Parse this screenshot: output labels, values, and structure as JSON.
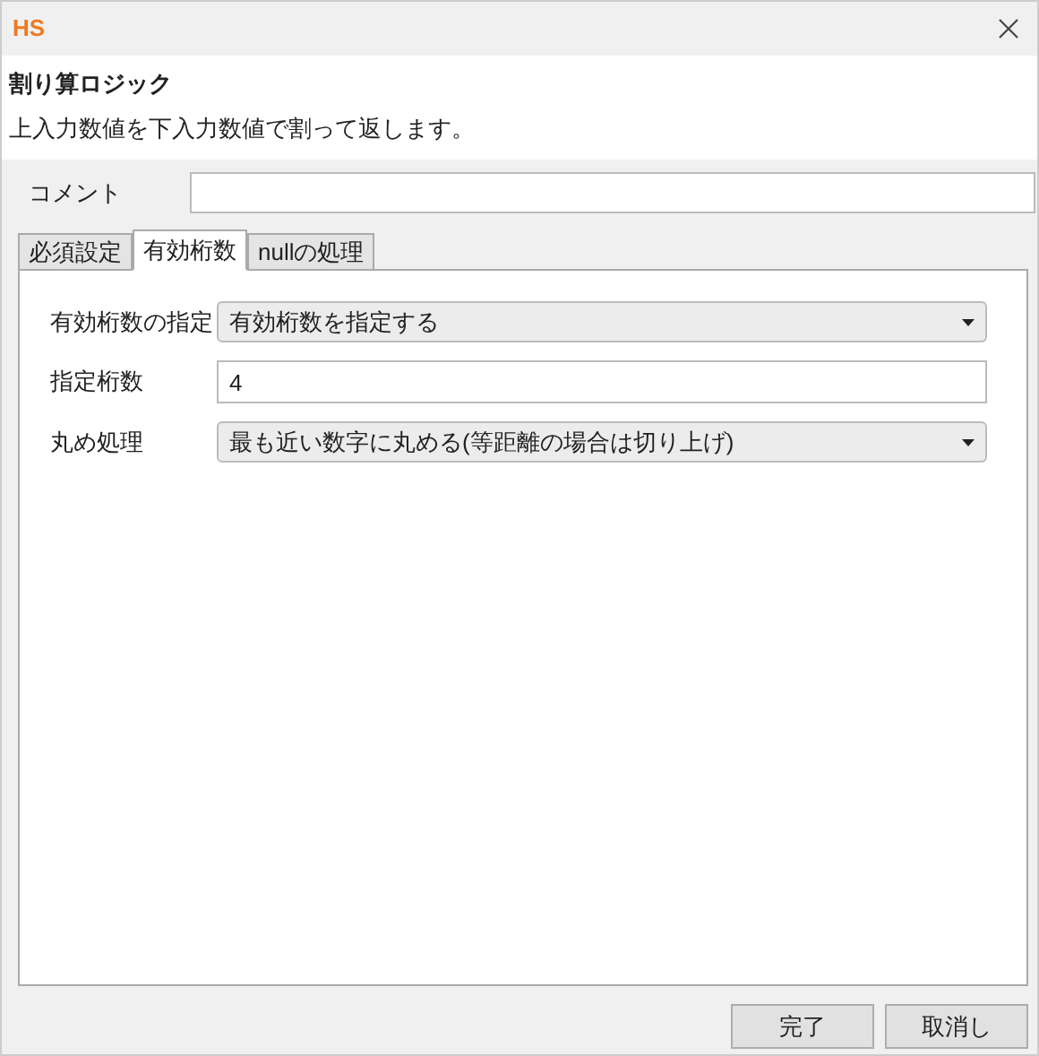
{
  "window": {
    "logo": "HS"
  },
  "header": {
    "title": "割り算ロジック",
    "description": "上入力数値を下入力数値で割って返します。"
  },
  "comment": {
    "label": "コメント"
  },
  "tabs": [
    {
      "label": "必須設定",
      "selected": false
    },
    {
      "label": "有効桁数",
      "selected": true
    },
    {
      "label": "nullの処理",
      "selected": false
    }
  ],
  "fields": [
    {
      "kind": "select",
      "label": "有効桁数の指定",
      "value": "有効桁数を指定する"
    },
    {
      "kind": "input",
      "label": "指定桁数",
      "value": "4"
    },
    {
      "kind": "select",
      "label": "丸め処理",
      "value": "最も近い数字に丸める(等距離の場合は切り上げ)"
    }
  ],
  "buttons": [
    "完了",
    "取消し"
  ]
}
